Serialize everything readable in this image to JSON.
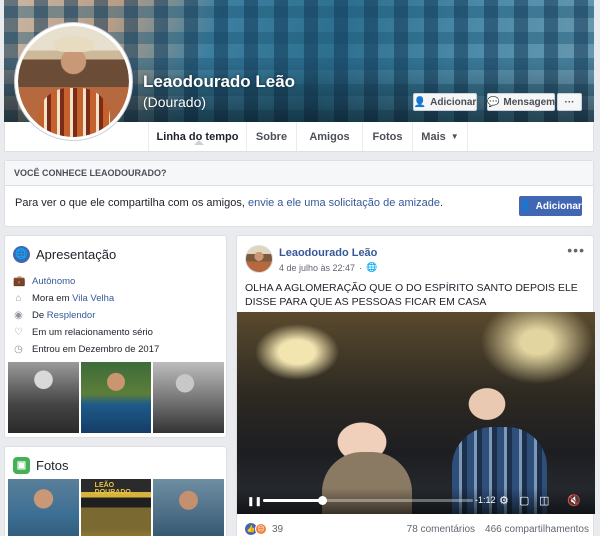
{
  "profile": {
    "name": "Leaodourado Leão",
    "alternate_name": "(Dourado)",
    "buttons": {
      "add_friend": "Adicionar",
      "message": "Mensagem",
      "more": "···"
    }
  },
  "tabs": [
    {
      "label": "Linha do tempo"
    },
    {
      "label": "Sobre"
    },
    {
      "label": "Amigos"
    },
    {
      "label": "Fotos"
    },
    {
      "label": "Mais"
    }
  ],
  "know_card": {
    "heading": "VOCÊ CONHECE LEAODOURADO?",
    "text_prefix": "Para ver o que ele compartilha com os amigos, ",
    "link_text": "envie a ele uma solicitação de amizade",
    "text_suffix": ".",
    "button": "Adicionar"
  },
  "intro": {
    "title": "Apresentação",
    "rows": [
      {
        "icon": "briefcase-icon",
        "link": "Autônomo",
        "prefix": ""
      },
      {
        "icon": "home-icon",
        "prefix": "Mora em ",
        "link": "Vila Velha"
      },
      {
        "icon": "location-icon",
        "prefix": "De ",
        "link": "Resplendor"
      },
      {
        "icon": "heart-icon",
        "prefix": "Em um relacionamento sério",
        "link": ""
      },
      {
        "icon": "clock-icon",
        "prefix": "Entrou em Dezembro de 2017",
        "link": ""
      }
    ]
  },
  "photos": {
    "title": "Fotos",
    "album_label": "LEÃO DOURADO"
  },
  "post": {
    "author": "Leaodourado Leão",
    "timestamp": "4 de julho às 22:47",
    "text": "OLHA A AGLOMERAÇÃO QUE O DO ESPÍRITO SANTO DEPOIS ELE DISSE PARA QUE AS PESSOAS FICAR EM CASA",
    "video": {
      "time": "-1:12",
      "progress": 0.28
    },
    "reactions_count": "39",
    "comments": "78 comentários",
    "shares": "466 compartilhamentos"
  },
  "colors": {
    "brand_blue": "#4267b2",
    "link_blue": "#365899",
    "page_bg": "#e9ebee"
  }
}
